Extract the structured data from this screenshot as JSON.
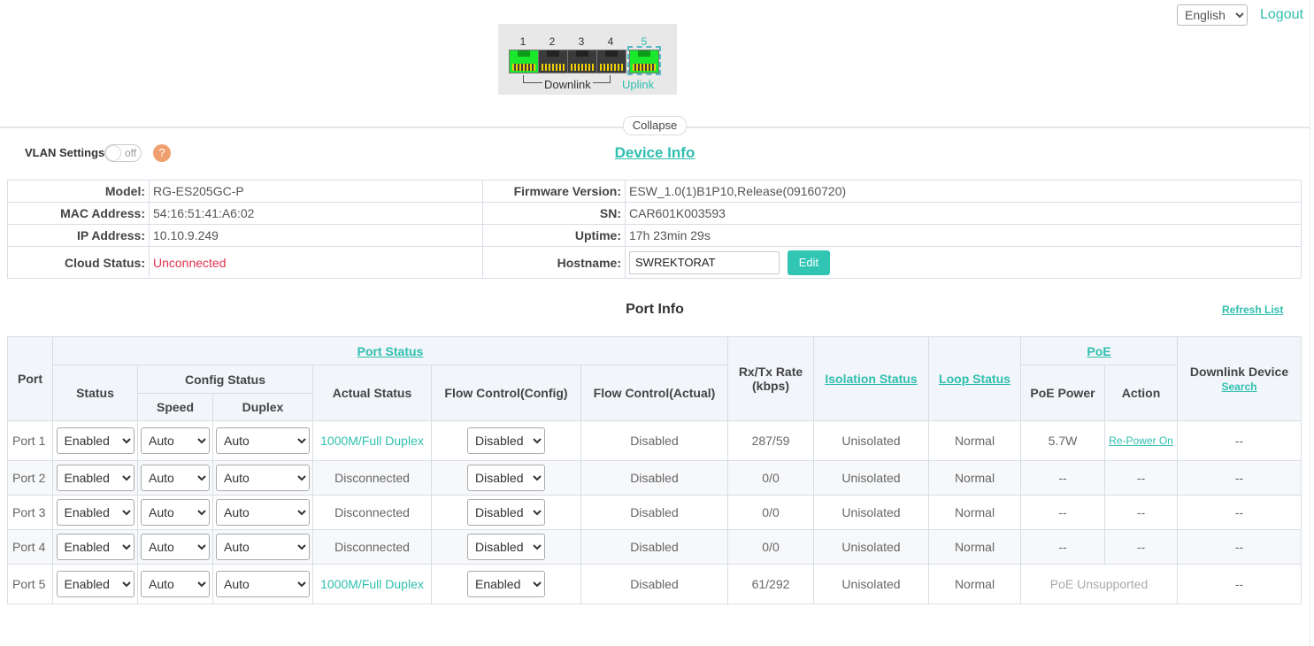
{
  "header": {
    "language": "English",
    "logout": "Logout"
  },
  "port_panel": {
    "ports": [
      {
        "number": "1",
        "link": "up"
      },
      {
        "number": "2",
        "link": "down"
      },
      {
        "number": "3",
        "link": "down"
      },
      {
        "number": "4",
        "link": "down"
      },
      {
        "number": "5",
        "link": "up"
      }
    ],
    "downlink_label": "Downlink",
    "uplink_label": "Uplink"
  },
  "collapse_label": "Collapse",
  "vlan": {
    "label": "VLAN Settings",
    "toggle_state": "off",
    "help": "?"
  },
  "device_info": {
    "title": "Device Info",
    "model_label": "Model:",
    "model": "RG-ES205GC-P",
    "firmware_label": "Firmware Version:",
    "firmware": "ESW_1.0(1)B1P10,Release(09160720)",
    "mac_label": "MAC Address:",
    "mac": "54:16:51:41:A6:02",
    "sn_label": "SN:",
    "sn": "CAR601K003593",
    "ip_label": "IP Address:",
    "ip": "10.10.9.249",
    "uptime_label": "Uptime:",
    "uptime": "17h 23min 29s",
    "cloud_label": "Cloud Status:",
    "cloud": "Unconnected",
    "hostname_label": "Hostname:",
    "hostname": "SWREKTORAT",
    "edit": "Edit"
  },
  "port_info": {
    "title": "Port Info",
    "refresh": "Refresh List",
    "headers": {
      "port": "Port",
      "port_status": "Port Status",
      "status": "Status",
      "config_status": "Config Status",
      "speed": "Speed",
      "duplex": "Duplex",
      "actual_status": "Actual Status",
      "flow_config": "Flow Control(Config)",
      "flow_actual": "Flow Control(Actual)",
      "rate": "Rx/Tx Rate (kbps)",
      "isolation": "Isolation Status",
      "loop": "Loop Status",
      "poe": "PoE",
      "poe_power": "PoE Power",
      "action": "Action",
      "downlink_device": "Downlink Device",
      "search": "Search"
    },
    "rows": [
      {
        "port": "Port 1",
        "status": "Enabled",
        "speed": "Auto",
        "duplex": "Auto",
        "actual": "1000M/Full Duplex",
        "flow_config": "Disabled",
        "flow_actual": "Disabled",
        "rate": "287/59",
        "isolation": "Unisolated",
        "loop": "Normal",
        "poe_power": "5.7W",
        "action": "Re-Power On",
        "downlink": "--"
      },
      {
        "port": "Port 2",
        "status": "Enabled",
        "speed": "Auto",
        "duplex": "Auto",
        "actual": "Disconnected",
        "flow_config": "Disabled",
        "flow_actual": "Disabled",
        "rate": "0/0",
        "isolation": "Unisolated",
        "loop": "Normal",
        "poe_power": "--",
        "action": "--",
        "downlink": "--"
      },
      {
        "port": "Port 3",
        "status": "Enabled",
        "speed": "Auto",
        "duplex": "Auto",
        "actual": "Disconnected",
        "flow_config": "Disabled",
        "flow_actual": "Disabled",
        "rate": "0/0",
        "isolation": "Unisolated",
        "loop": "Normal",
        "poe_power": "--",
        "action": "--",
        "downlink": "--"
      },
      {
        "port": "Port 4",
        "status": "Enabled",
        "speed": "Auto",
        "duplex": "Auto",
        "actual": "Disconnected",
        "flow_config": "Disabled",
        "flow_actual": "Disabled",
        "rate": "0/0",
        "isolation": "Unisolated",
        "loop": "Normal",
        "poe_power": "--",
        "action": "--",
        "downlink": "--"
      },
      {
        "port": "Port 5",
        "status": "Enabled",
        "speed": "Auto",
        "duplex": "Auto",
        "actual": "1000M/Full Duplex",
        "flow_config": "Enabled",
        "flow_actual": "Disabled",
        "rate": "61/292",
        "isolation": "Unisolated",
        "loop": "Normal",
        "poe_unsupported": "PoE Unsupported",
        "downlink": "--"
      }
    ]
  },
  "colors": {
    "accent": "#2fbfaf",
    "button": "#31c6b4",
    "error": "#e0334e",
    "port_up": "#19e82c",
    "port_down": "#3b3b3b",
    "help_badge": "#f0a06e"
  }
}
